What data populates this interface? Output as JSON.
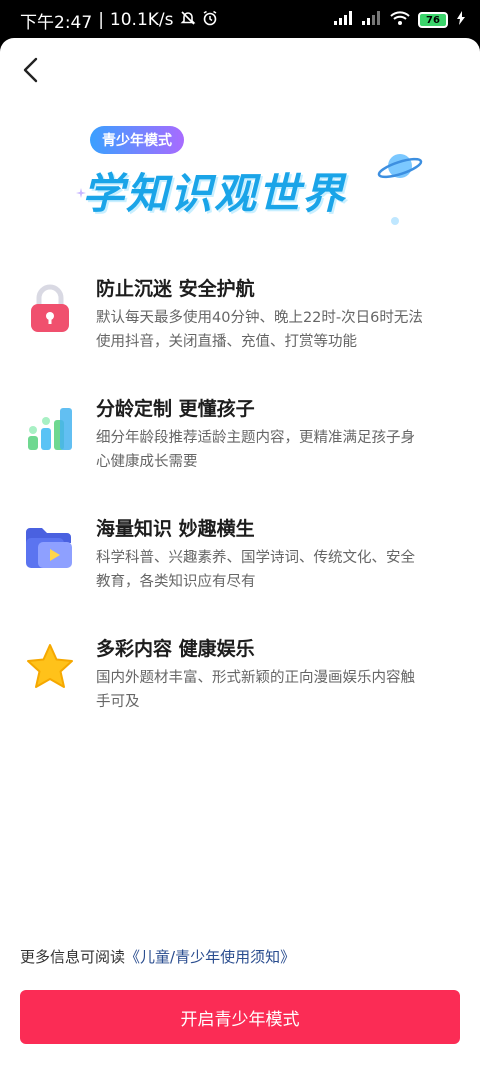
{
  "status_bar": {
    "time": "下午2:47",
    "speed": "10.1K/s",
    "battery": "76"
  },
  "banner": {
    "badge": "青少年模式",
    "headline": "学知识观世界"
  },
  "features": [
    {
      "icon": "lock-icon",
      "title": "防止沉迷 安全护航",
      "desc_line1": "默认每天最多使用40分钟、晚上22时-次日6时无法",
      "desc_line2": "使用抖音，关闭直播、充值、打赏等功能"
    },
    {
      "icon": "bar-chart-icon",
      "title": "分龄定制 更懂孩子",
      "desc_line1": "细分年龄段推荐适龄主题内容，更精准满足孩子身",
      "desc_line2": "心健康成长需要"
    },
    {
      "icon": "video-folder-icon",
      "title": "海量知识 妙趣横生",
      "desc_line1": "科学科普、兴趣素养、国学诗词、传统文化、安全",
      "desc_line2": "教育，各类知识应有尽有"
    },
    {
      "icon": "star-icon",
      "title": "多彩内容 健康娱乐",
      "desc_line1": "国内外题材丰富、形式新颖的正向漫画娱乐内容触",
      "desc_line2": "手可及"
    }
  ],
  "footnote": {
    "prefix": "更多信息可阅读",
    "link": "《儿童/青少年使用须知》"
  },
  "primary_button": "开启青少年模式",
  "colors": {
    "accent": "#fb2c55",
    "link": "#2a4d8f",
    "headline": "#1aa4e8"
  }
}
